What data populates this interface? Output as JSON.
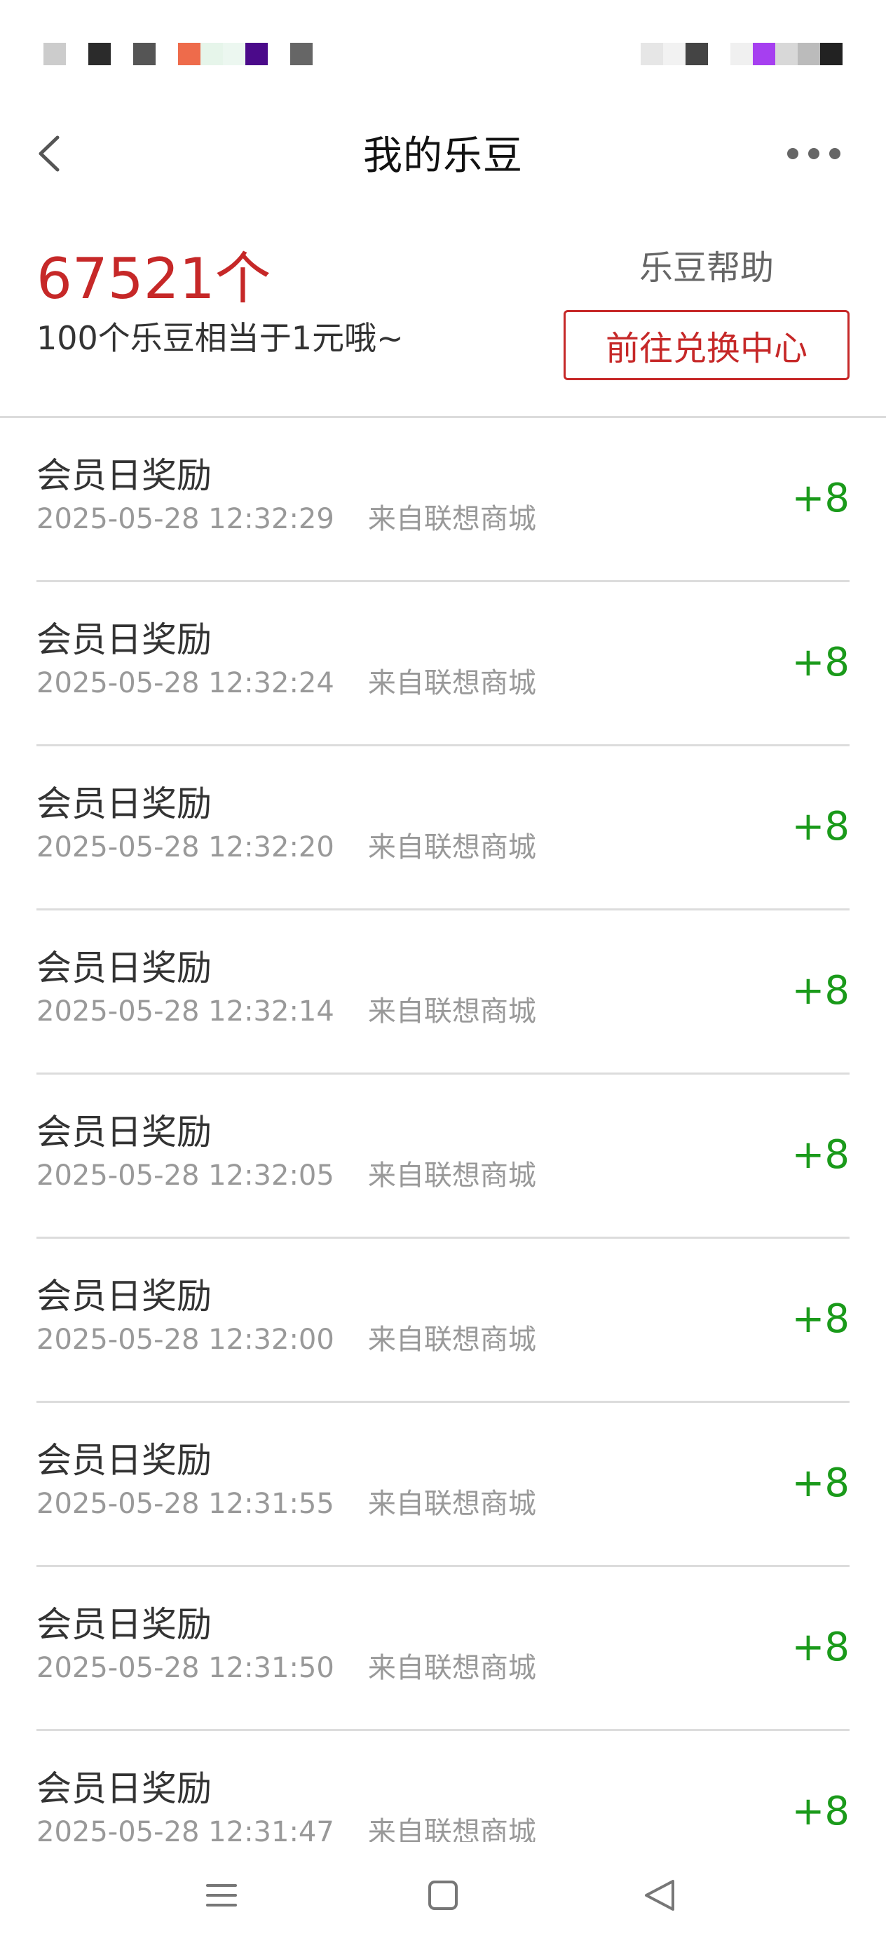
{
  "status_bar": {
    "left_blocks": [
      "#cccccc",
      "#ffffff",
      "#2b2b2b",
      "#ffffff",
      "#555555",
      "#ffffff",
      "#ee6b4b",
      "#e6f5ea",
      "#ecf7f0",
      "#4b0a8a",
      "#ffffff",
      "#666666"
    ],
    "right_blocks": [
      "#e6e6e6",
      "#f2f2f2",
      "#444444",
      "#ffffff",
      "#f0f0f0",
      "#a63ff0",
      "#d8d8d8",
      "#bbbbbb",
      "#222222"
    ]
  },
  "nav": {
    "back_icon": "chevron-left-icon",
    "title": "我的乐豆",
    "more_icon": "more-horizontal-icon"
  },
  "summary": {
    "balance": "67521个",
    "rate_note": "100个乐豆相当于1元哦~",
    "help_label": "乐豆帮助",
    "exchange_label": "前往兑换中心"
  },
  "colors": {
    "accent_red": "#c62828",
    "amount_green": "#1a9a1a",
    "divider": "#dcdcdc"
  },
  "records": [
    {
      "title": "会员日奖励",
      "time": "2025-05-28 12:32:29",
      "source": "来自联想商城",
      "amount": "+8"
    },
    {
      "title": "会员日奖励",
      "time": "2025-05-28 12:32:24",
      "source": "来自联想商城",
      "amount": "+8"
    },
    {
      "title": "会员日奖励",
      "time": "2025-05-28 12:32:20",
      "source": "来自联想商城",
      "amount": "+8"
    },
    {
      "title": "会员日奖励",
      "time": "2025-05-28 12:32:14",
      "source": "来自联想商城",
      "amount": "+8"
    },
    {
      "title": "会员日奖励",
      "time": "2025-05-28 12:32:05",
      "source": "来自联想商城",
      "amount": "+8"
    },
    {
      "title": "会员日奖励",
      "time": "2025-05-28 12:32:00",
      "source": "来自联想商城",
      "amount": "+8"
    },
    {
      "title": "会员日奖励",
      "time": "2025-05-28 12:31:55",
      "source": "来自联想商城",
      "amount": "+8"
    },
    {
      "title": "会员日奖励",
      "time": "2025-05-28 12:31:50",
      "source": "来自联想商城",
      "amount": "+8"
    },
    {
      "title": "会员日奖励",
      "time": "2025-05-28 12:31:47",
      "source": "来自联想商城",
      "amount": "+8"
    }
  ],
  "system_nav": {
    "menu_icon": "menu-icon",
    "home_icon": "home-square-icon",
    "back_icon": "back-triangle-icon"
  }
}
